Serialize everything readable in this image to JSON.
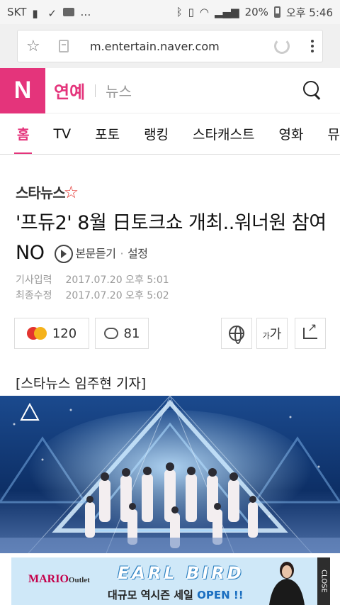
{
  "status_bar": {
    "carrier": "SKT",
    "battery": "20%",
    "time": "오후 5:46"
  },
  "browser": {
    "url": "m.entertain.naver.com"
  },
  "header": {
    "logo": "N",
    "section": "연예",
    "subsection": "뉴스"
  },
  "tabs": [
    {
      "label": "홈"
    },
    {
      "label": "TV"
    },
    {
      "label": "포토"
    },
    {
      "label": "랭킹"
    },
    {
      "label": "스타캐스트"
    },
    {
      "label": "영화"
    },
    {
      "label": "뮤"
    }
  ],
  "article": {
    "press": "스타뉴스",
    "headline": "'프듀2' 8월 日토크쇼 개최..워너원 참여NO",
    "listen_label": "본문듣기",
    "settings_label": "설정",
    "input_label": "기사입력",
    "input_time": "2017.07.20 오후 5:01",
    "modified_label": "최종수정",
    "modified_time": "2017.07.20 오후 5:02",
    "reaction_count": "120",
    "comment_count": "81",
    "font_label_small": "가",
    "font_label_big": "가",
    "reporter": "[스타뉴스 임주현 기자]"
  },
  "ad": {
    "brand": "MARIO",
    "brand_suffix": "Outlet",
    "headline": "EARL BIRD",
    "sub": "대규모 역시즌 세일",
    "open": "OPEN !!",
    "close": "CLOSE"
  },
  "colors": {
    "accent": "#e4347b",
    "photo_bg": "#0b2e63"
  }
}
